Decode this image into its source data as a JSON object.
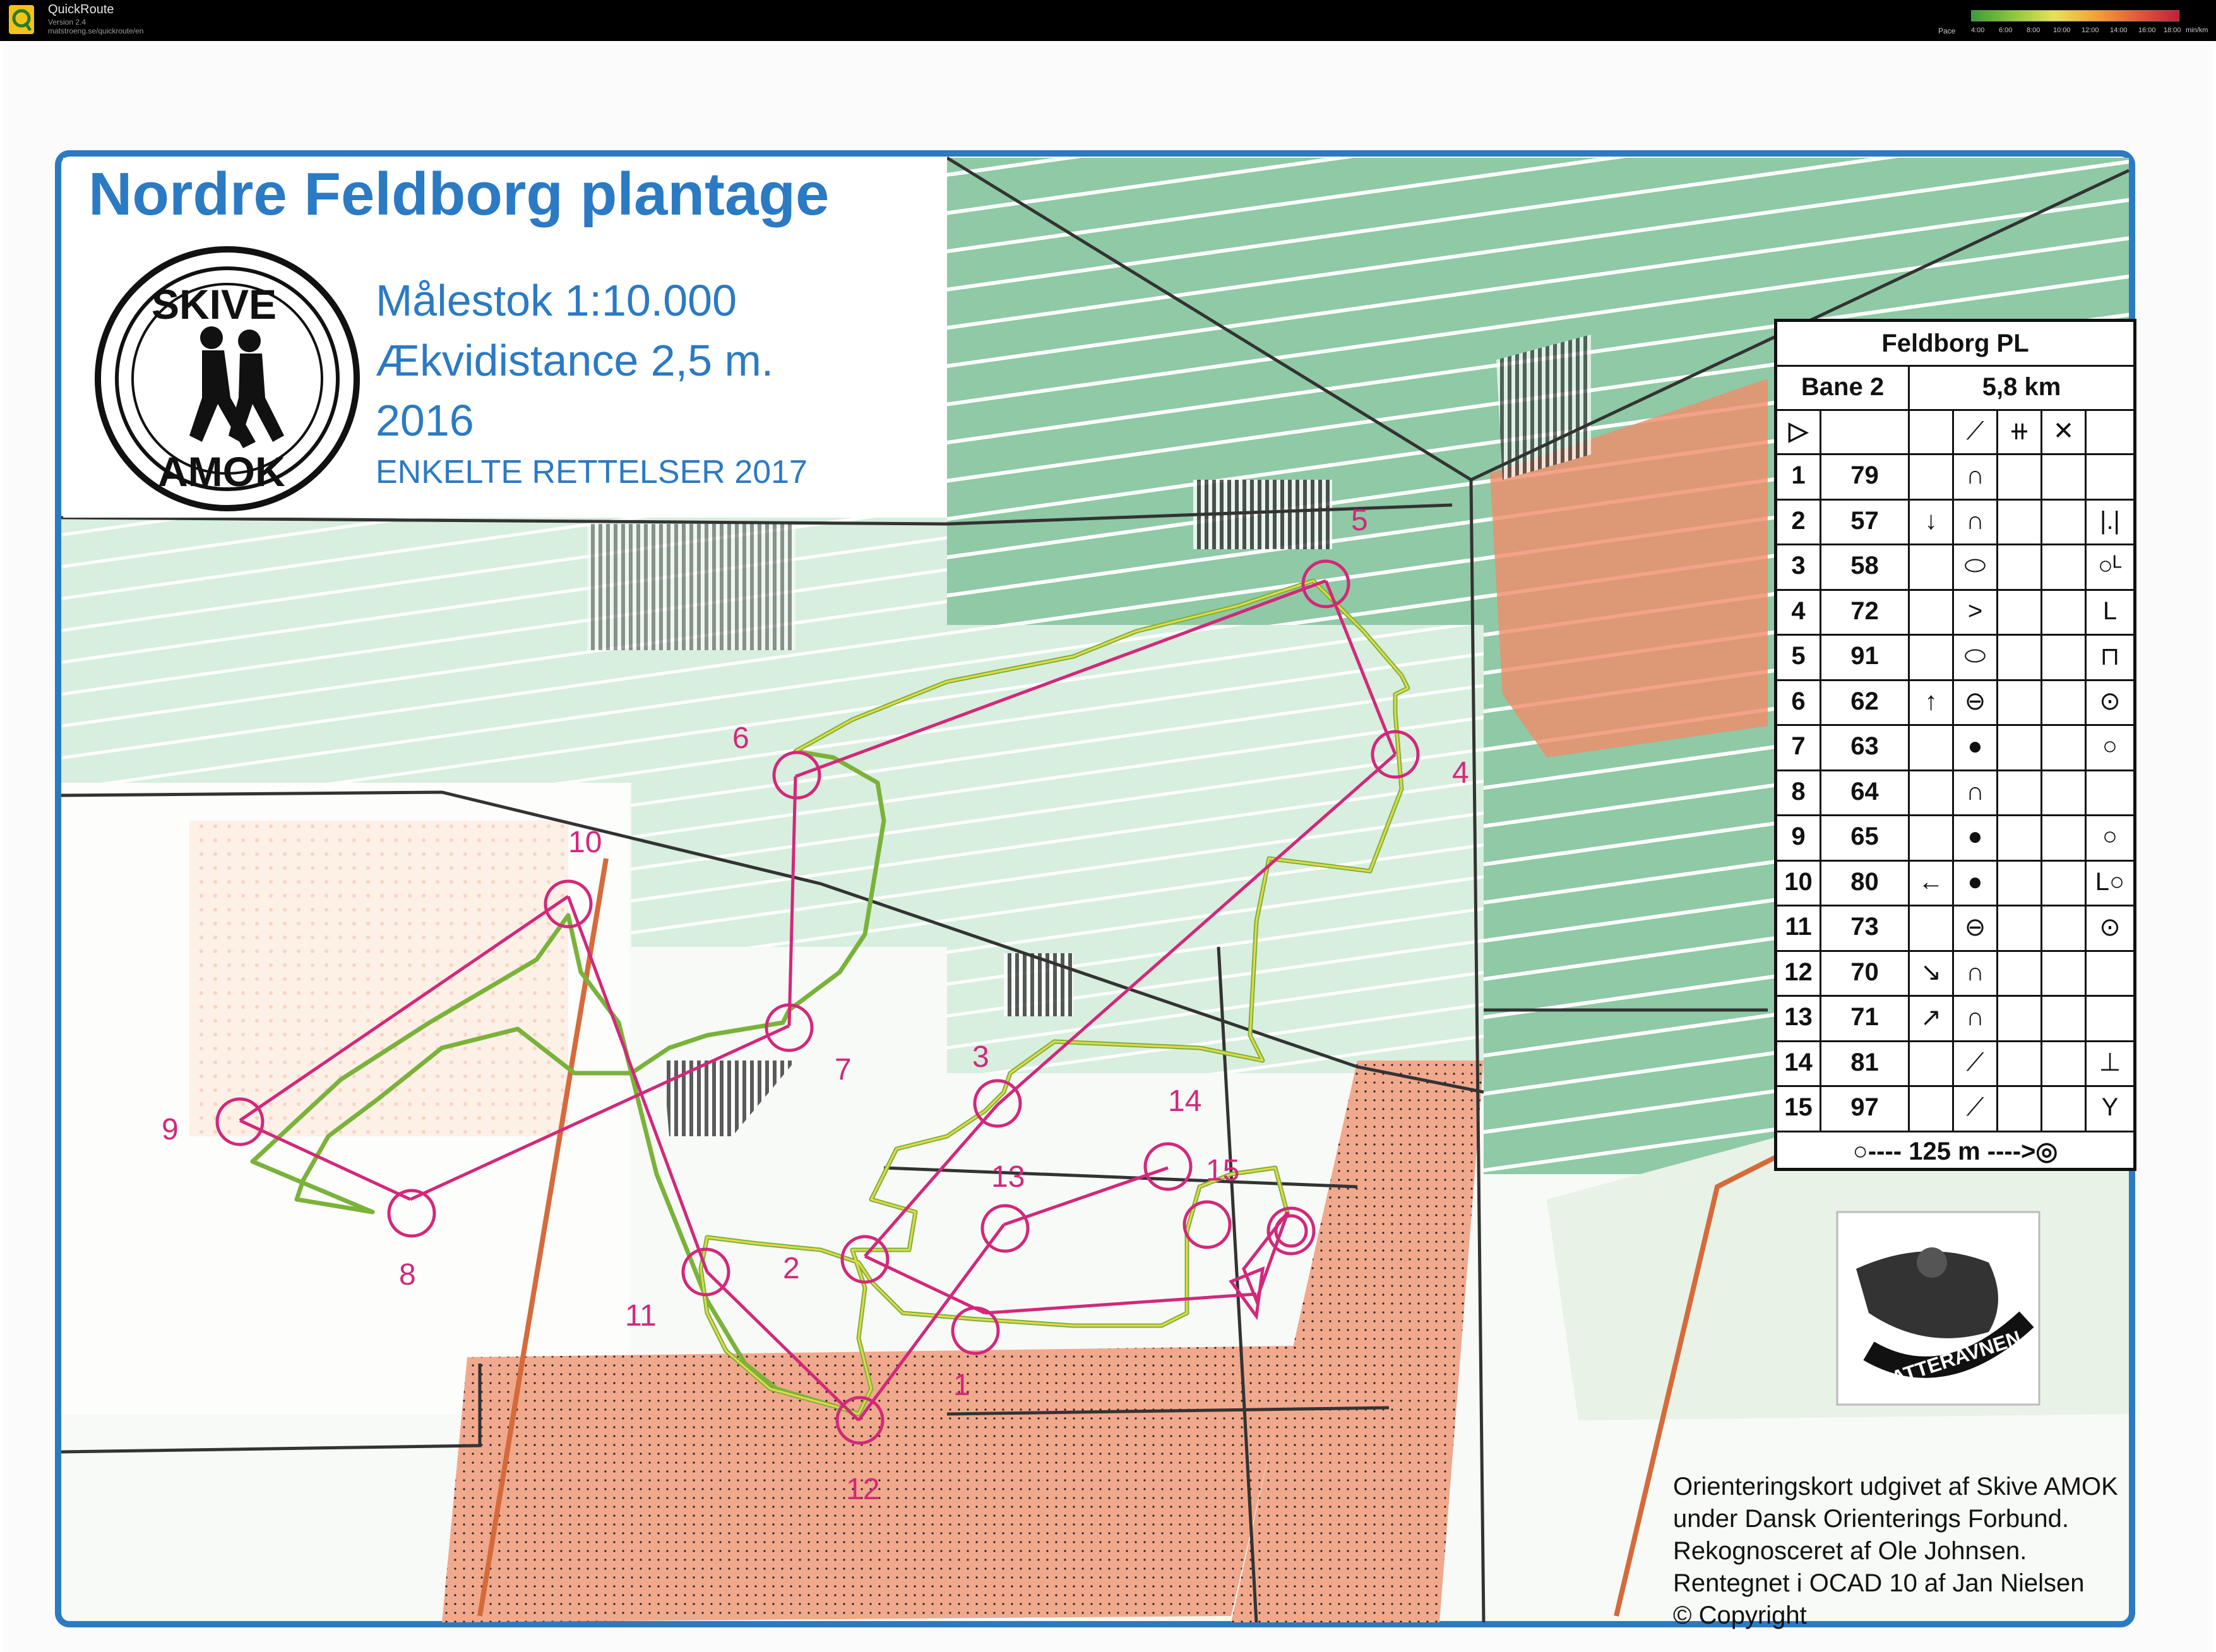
{
  "app": {
    "name": "QuickRoute",
    "version": "Version 2.4",
    "url": "matstroeng.se/quickroute/en"
  },
  "pace_legend": {
    "label": "Pace",
    "ticks": [
      "4:00",
      "6:00",
      "8:00",
      "10:00",
      "12:00",
      "14:00",
      "16:00",
      "18:00"
    ],
    "unit": "min/km",
    "colors": [
      "#3a9a3a",
      "#8cc63f",
      "#e8e05a",
      "#f2a23a",
      "#e25a3a",
      "#c0203a"
    ]
  },
  "map": {
    "title": "Nordre Feldborg plantage",
    "club_logo_top": "SKIVE",
    "club_logo_bottom": "AMOK",
    "scale_line": "Målestok 1:10.000",
    "contour_line": "Ækvidistance 2,5 m.",
    "year": "2016",
    "revision": "ENKELTE RETTELSER 2017",
    "route_color": "#d2287a",
    "track_color": "#7ab23a",
    "frame_color": "#2b7ac4",
    "controls": [
      {
        "label": "1"
      },
      {
        "label": "2"
      },
      {
        "label": "3"
      },
      {
        "label": "4"
      },
      {
        "label": "5"
      },
      {
        "label": "6"
      },
      {
        "label": "7"
      },
      {
        "label": "8"
      },
      {
        "label": "9"
      },
      {
        "label": "10"
      },
      {
        "label": "11"
      },
      {
        "label": "12"
      },
      {
        "label": "13"
      },
      {
        "label": "14"
      },
      {
        "label": "15"
      }
    ]
  },
  "description_sheet": {
    "header": "Feldborg PL",
    "course": "Bane 2",
    "length": "5,8 km",
    "rows": [
      {
        "num": "1",
        "code": "79",
        "dir": "",
        "feature": "∩",
        "pos": ""
      },
      {
        "num": "2",
        "code": "57",
        "dir": "↓",
        "feature": "∩",
        "pos": "|.|"
      },
      {
        "num": "3",
        "code": "58",
        "dir": "",
        "feature": "⬭",
        "pos": "○ᴸ"
      },
      {
        "num": "4",
        "code": "72",
        "dir": "",
        "feature": ">",
        "pos": "L"
      },
      {
        "num": "5",
        "code": "91",
        "dir": "",
        "feature": "⬭",
        "pos": "⊓"
      },
      {
        "num": "6",
        "code": "62",
        "dir": "↑",
        "feature": "⊖",
        "pos": "⊙"
      },
      {
        "num": "7",
        "code": "63",
        "dir": "",
        "feature": "●",
        "pos": "○"
      },
      {
        "num": "8",
        "code": "64",
        "dir": "",
        "feature": "∩",
        "pos": ""
      },
      {
        "num": "9",
        "code": "65",
        "dir": "",
        "feature": "●",
        "pos": "○"
      },
      {
        "num": "10",
        "code": "80",
        "dir": "←",
        "feature": "●",
        "pos": "L○"
      },
      {
        "num": "11",
        "code": "73",
        "dir": "",
        "feature": "⊖",
        "pos": "⊙"
      },
      {
        "num": "12",
        "code": "70",
        "dir": "↘",
        "feature": "∩",
        "pos": ""
      },
      {
        "num": "13",
        "code": "71",
        "dir": "↗",
        "feature": "∩",
        "pos": ""
      },
      {
        "num": "14",
        "code": "81",
        "dir": "",
        "feature": "⟋",
        "pos": "⊥"
      },
      {
        "num": "15",
        "code": "97",
        "dir": "",
        "feature": "⟋",
        "pos": "Y"
      }
    ],
    "start_symbol": "▷",
    "finish_text": "○---- 125 m ---->◎"
  },
  "sponsor_logo": "NATTERAVNEN",
  "copyright": [
    "Orienteringskort udgivet af Skive AMOK",
    "under Dansk Orienterings Forbund.",
    "Rekognosceret af Ole Johnsen.",
    "Rentegnet i OCAD 10 af Jan Nielsen",
    "© Copyright"
  ]
}
